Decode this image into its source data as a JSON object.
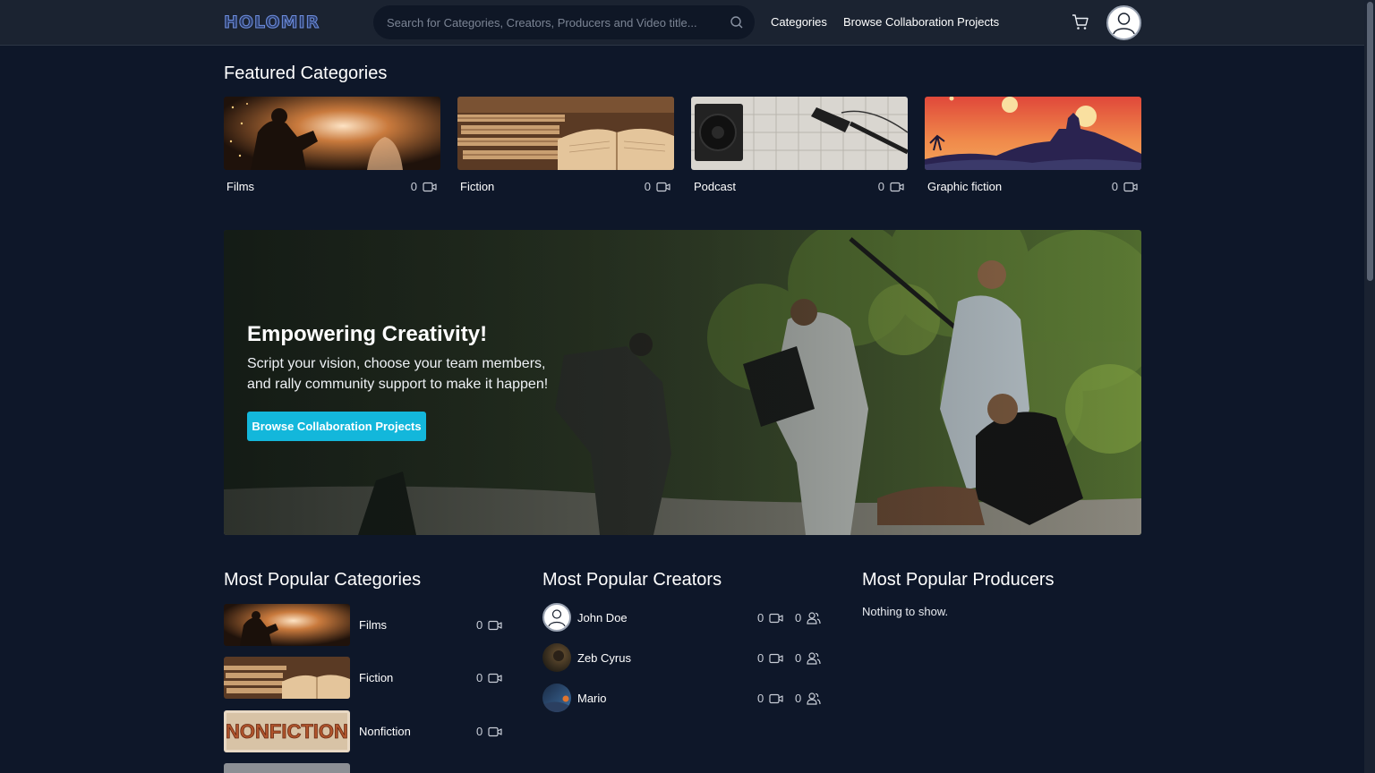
{
  "header": {
    "logo": "HOLOMIR",
    "search_placeholder": "Search for Categories, Creators, Producers and Video title...",
    "nav": {
      "categories": "Categories",
      "browse_projects": "Browse Collaboration Projects"
    }
  },
  "featured": {
    "title": "Featured Categories",
    "items": [
      {
        "name": "Films",
        "count": "0"
      },
      {
        "name": "Fiction",
        "count": "0"
      },
      {
        "name": "Podcast",
        "count": "0"
      },
      {
        "name": "Graphic fiction",
        "count": "0"
      }
    ]
  },
  "hero": {
    "title": "Empowering Creativity!",
    "subtitle": "Script your vision, choose your team members, and rally community support to make it happen!",
    "button": "Browse Collaboration Projects"
  },
  "popular_categories": {
    "title": "Most Popular Categories",
    "items": [
      {
        "name": "Films",
        "count": "0"
      },
      {
        "name": "Fiction",
        "count": "0"
      },
      {
        "name": "Nonfiction",
        "count": "0",
        "thumb_text": "NONFICTION"
      }
    ]
  },
  "popular_creators": {
    "title": "Most Popular Creators",
    "items": [
      {
        "name": "John Doe",
        "videos": "0",
        "followers": "0"
      },
      {
        "name": "Zeb Cyrus",
        "videos": "0",
        "followers": "0"
      },
      {
        "name": "Mario",
        "videos": "0",
        "followers": "0"
      }
    ]
  },
  "popular_producers": {
    "title": "Most Popular Producers",
    "empty_text": "Nothing to show."
  },
  "colors": {
    "background": "#0e1729",
    "header": "#1b2331",
    "accent": "#13b7db"
  },
  "icons": [
    "search-icon",
    "cart-icon",
    "user-icon",
    "video-camera-icon",
    "users-icon"
  ]
}
